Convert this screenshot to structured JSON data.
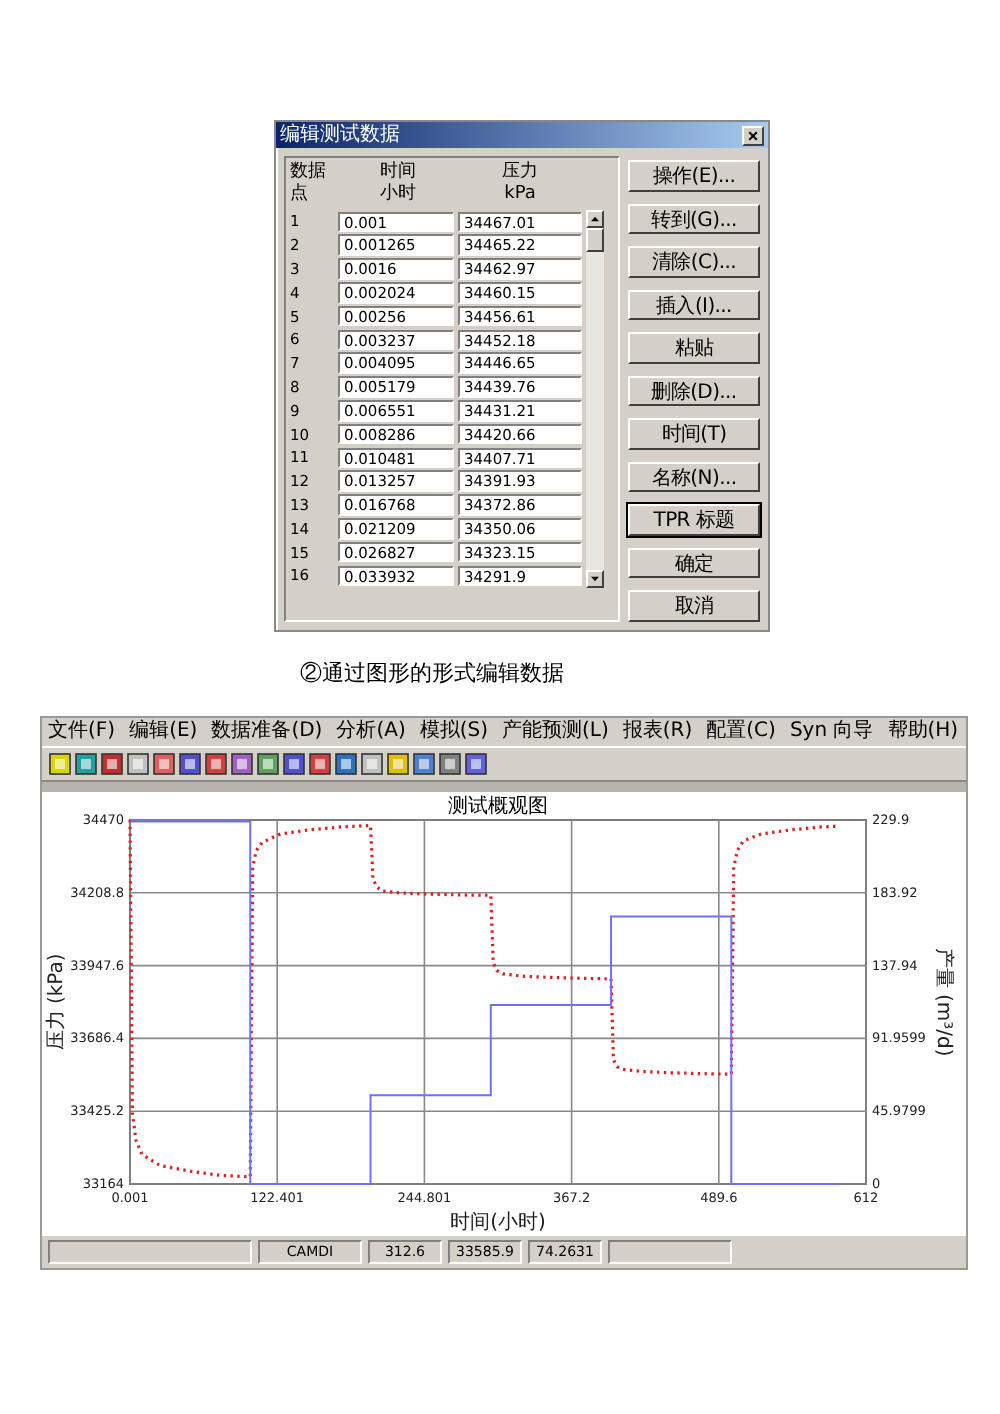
{
  "dialog": {
    "title": "编辑测试数据",
    "close": "×",
    "columns": [
      {
        "top": "数据",
        "bottom": "点"
      },
      {
        "top": "时间",
        "bottom": "小时"
      },
      {
        "top": "压力",
        "bottom": "kPa"
      }
    ],
    "rows": [
      {
        "n": "1",
        "time": "0.001",
        "pressure": "34467.01"
      },
      {
        "n": "2",
        "time": "0.001265",
        "pressure": "34465.22"
      },
      {
        "n": "3",
        "time": "0.0016",
        "pressure": "34462.97"
      },
      {
        "n": "4",
        "time": "0.002024",
        "pressure": "34460.15"
      },
      {
        "n": "5",
        "time": "0.00256",
        "pressure": "34456.61"
      },
      {
        "n": "6",
        "time": "0.003237",
        "pressure": "34452.18"
      },
      {
        "n": "7",
        "time": "0.004095",
        "pressure": "34446.65"
      },
      {
        "n": "8",
        "time": "0.005179",
        "pressure": "34439.76"
      },
      {
        "n": "9",
        "time": "0.006551",
        "pressure": "34431.21"
      },
      {
        "n": "10",
        "time": "0.008286",
        "pressure": "34420.66"
      },
      {
        "n": "11",
        "time": "0.010481",
        "pressure": "34407.71"
      },
      {
        "n": "12",
        "time": "0.013257",
        "pressure": "34391.93"
      },
      {
        "n": "13",
        "time": "0.016768",
        "pressure": "34372.86"
      },
      {
        "n": "14",
        "time": "0.021209",
        "pressure": "34350.06"
      },
      {
        "n": "15",
        "time": "0.026827",
        "pressure": "34323.15"
      },
      {
        "n": "16",
        "time": "0.033932",
        "pressure": "34291.9"
      }
    ],
    "buttons": [
      {
        "label": "操作(E)...",
        "kind": "normal"
      },
      {
        "label": "转到(G)...",
        "kind": "normal"
      },
      {
        "label": "清除(C)...",
        "kind": "normal"
      },
      {
        "label": "插入(I)...",
        "kind": "normal"
      },
      {
        "label": "粘贴",
        "kind": "normal"
      },
      {
        "label": "删除(D)...",
        "kind": "normal"
      },
      {
        "label": "时间(T)",
        "kind": "normal"
      },
      {
        "label": "名称(N)...",
        "kind": "normal"
      },
      {
        "label": "TPR 标题",
        "kind": "default"
      },
      {
        "label": "确定",
        "kind": "normal"
      },
      {
        "label": "取消",
        "kind": "normal"
      }
    ]
  },
  "caption": "②通过图形的形式编辑数据",
  "app": {
    "menu": [
      "文件(F)",
      "编辑(E)",
      "数据准备(D)",
      "分析(A)",
      "模拟(S)",
      "产能预测(L)",
      "报表(R)",
      "配置(C)",
      "Syn 向导",
      "帮助(H)"
    ],
    "chart_data": {
      "type": "line",
      "title": "测试概观图",
      "xlabel": "时间(小时)",
      "ylabel": "压力 (kPa)",
      "y2label": "产量 (m³/d)",
      "x": [
        0.001,
        2,
        5,
        10,
        25,
        50,
        75,
        99,
        100,
        102,
        105,
        110,
        125,
        150,
        175,
        199,
        200,
        202,
        205,
        210,
        225,
        250,
        275,
        299,
        300,
        302,
        305,
        310,
        325,
        350,
        375,
        399,
        400,
        402,
        405,
        410,
        425,
        450,
        475,
        499,
        500,
        502,
        505,
        510,
        525,
        550,
        575,
        590
      ],
      "series": [
        {
          "color": "#e02020",
          "line_style": "dotted",
          "values": [
            34470,
            33420,
            33320,
            33270,
            33230,
            33210,
            33195,
            33190,
            33190,
            34300,
            34360,
            34390,
            34420,
            34435,
            34445,
            34450,
            34450,
            34260,
            34230,
            34215,
            34208,
            34204,
            34201,
            34200,
            34200,
            33960,
            33930,
            33918,
            33910,
            33905,
            33902,
            33900,
            33900,
            33610,
            33585,
            33575,
            33568,
            33563,
            33560,
            33558,
            33558,
            34300,
            34360,
            34395,
            34420,
            34435,
            34445,
            34448
          ]
        },
        {
          "color": "#7070ff",
          "axis": "y2",
          "values": [
            229,
            229,
            229,
            229,
            229,
            229,
            229,
            229,
            0,
            0,
            0,
            0,
            0,
            0,
            0,
            0,
            56,
            56,
            56,
            56,
            56,
            56,
            56,
            56,
            113,
            113,
            113,
            113,
            113,
            113,
            113,
            113,
            169,
            169,
            169,
            169,
            169,
            169,
            169,
            169,
            0,
            0,
            0,
            0,
            0,
            0,
            0,
            0
          ]
        }
      ],
      "grid": true,
      "xlim": [
        0.001,
        612
      ],
      "ylim": [
        33164,
        34470
      ],
      "y2lim": [
        0,
        229.9
      ],
      "xticks": [
        {
          "value": 0.001,
          "label": "0.001"
        },
        {
          "value": 122.401,
          "label": "122.401"
        },
        {
          "value": 244.801,
          "label": "244.801"
        },
        {
          "value": 367.2,
          "label": "367.2"
        },
        {
          "value": 489.6,
          "label": "489.6"
        },
        {
          "value": 612,
          "label": "612"
        }
      ],
      "yticks": [
        {
          "value": 33164,
          "label": "33164"
        },
        {
          "value": 33425.2,
          "label": "33425.2"
        },
        {
          "value": 33686.4,
          "label": "33686.4"
        },
        {
          "value": 33947.6,
          "label": "33947.6"
        },
        {
          "value": 34208.8,
          "label": "34208.8"
        },
        {
          "value": 34470,
          "label": "34470"
        }
      ],
      "y2ticks": [
        {
          "value": 0,
          "label": "0"
        },
        {
          "value": 45.9799,
          "label": "45.9799"
        },
        {
          "value": 91.9599,
          "label": "91.9599"
        },
        {
          "value": 137.94,
          "label": "137.94"
        },
        {
          "value": 183.92,
          "label": "183.92"
        },
        {
          "value": 229.9,
          "label": "229.9"
        }
      ]
    },
    "status": [
      "CAMDI",
      "312.6",
      "33585.9",
      "74.2631"
    ]
  }
}
